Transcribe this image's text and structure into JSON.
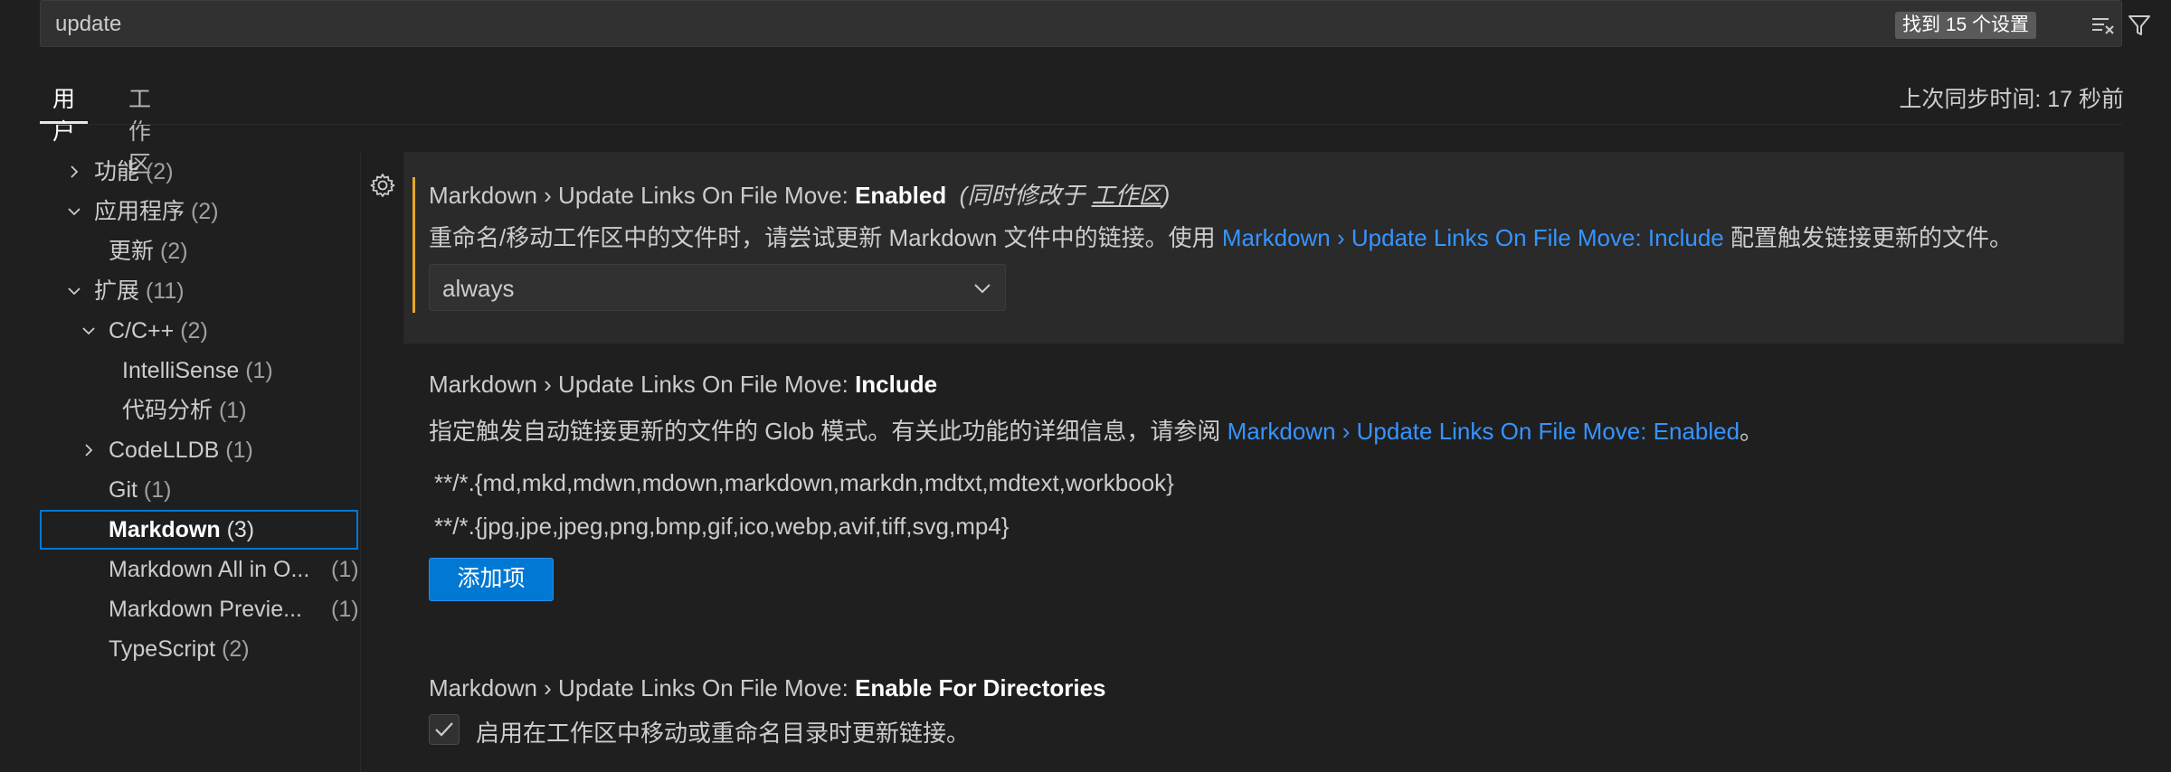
{
  "search": {
    "value": "update",
    "result_count": "找到 15 个设置",
    "icons": [
      "clear-filter-icon",
      "filter-icon"
    ]
  },
  "tabs": [
    {
      "label": "用户",
      "active": true
    },
    {
      "label": "工作区",
      "active": false
    }
  ],
  "sync_status": "上次同步时间: 17 秒前",
  "tree": [
    {
      "label": "功能",
      "count": "(2)",
      "expanded": false
    },
    {
      "label": "应用程序",
      "count": "(2)",
      "expanded": true
    },
    {
      "label": "更新",
      "count": "(2)"
    },
    {
      "label": "扩展",
      "count": "(11)",
      "expanded": true
    },
    {
      "label": "C/C++",
      "count": "(2)",
      "expanded": true
    },
    {
      "label": "IntelliSense",
      "count": "(1)"
    },
    {
      "label": "代码分析",
      "count": "(1)"
    },
    {
      "label": "CodeLLDB",
      "count": "(1)",
      "expanded": false
    },
    {
      "label": "Git",
      "count": "(1)"
    },
    {
      "label": "Markdown",
      "count": "(3)",
      "selected": true
    },
    {
      "label": "Markdown All in O...",
      "count": "(1)"
    },
    {
      "label": "Markdown Previe...",
      "count": "(1)"
    },
    {
      "label": "TypeScript",
      "count": "(2)"
    }
  ],
  "settings": [
    {
      "title_prefix": "Markdown › Update Links On File Move: ",
      "title_key": "Enabled",
      "scope_pre": "(同时修改于 ",
      "scope_link": "工作区",
      "scope_post": ")",
      "desc_pre": "重命名/移动工作区中的文件时，请尝试更新 Markdown 文件中的链接。使用 ",
      "desc_link": "Markdown › Update Links On File Move: Include",
      "desc_post": " 配置触发链接更新的文件。",
      "value": "always"
    },
    {
      "title_prefix": "Markdown › Update Links On File Move: ",
      "title_key": "Include",
      "desc_pre": "指定触发自动链接更新的文件的 Glob 模式。有关此功能的详细信息，请参阅 ",
      "desc_link": "Markdown › Update Links On File Move: Enabled",
      "desc_post": "。",
      "items": [
        "**/*.{md,mkd,mdwn,mdown,markdown,markdn,mdtxt,mdtext,workbook}",
        "**/*.{jpg,jpe,jpeg,png,bmp,gif,ico,webp,avif,tiff,svg,mp4}"
      ],
      "add_label": "添加项"
    },
    {
      "title_prefix": "Markdown › Update Links On File Move: ",
      "title_key": "Enable For Directories",
      "checkbox_label": "启用在工作区中移动或重命名目录时更新链接。",
      "checked": true
    }
  ],
  "colors": {
    "background": "#1f1f1f",
    "accent": "#0078d4",
    "link": "#3794ff",
    "modified": "#e6a72a"
  }
}
